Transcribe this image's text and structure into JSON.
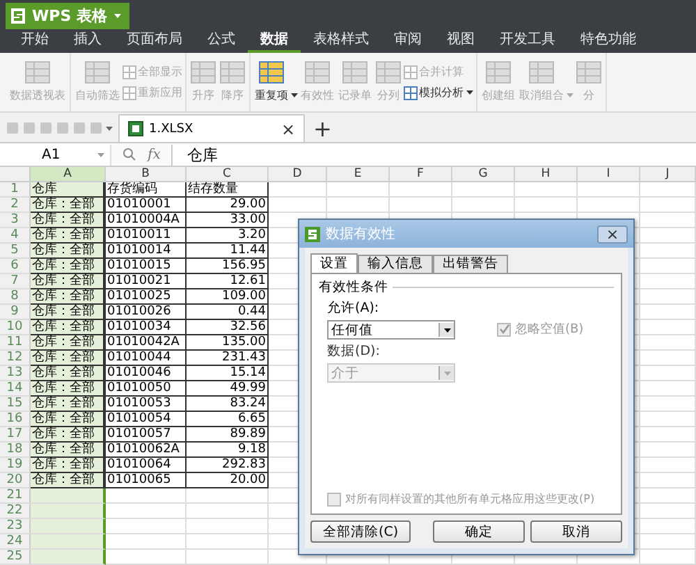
{
  "app_button": {
    "label": "WPS 表格"
  },
  "menu_tabs": [
    {
      "label": "开始",
      "selected": false
    },
    {
      "label": "插入",
      "selected": false
    },
    {
      "label": "页面布局",
      "selected": false
    },
    {
      "label": "公式",
      "selected": false
    },
    {
      "label": "数据",
      "selected": true
    },
    {
      "label": "表格样式",
      "selected": false
    },
    {
      "label": "审阅",
      "selected": false
    },
    {
      "label": "视图",
      "selected": false
    },
    {
      "label": "开发工具",
      "selected": false
    },
    {
      "label": "特色功能",
      "selected": false
    }
  ],
  "ribbon_groups": [
    {
      "items": [
        {
          "kind": "large",
          "label": "数据透视表",
          "disabled": true
        }
      ]
    },
    {
      "items": [
        {
          "kind": "large",
          "label": "自动筛选",
          "disabled": true
        },
        {
          "kind": "pair",
          "buttons": [
            {
              "label": "全部显示",
              "disabled": true
            },
            {
              "label": "重新应用",
              "disabled": true
            }
          ]
        }
      ]
    },
    {
      "items": [
        {
          "kind": "large",
          "label": "升序",
          "disabled": true
        },
        {
          "kind": "large",
          "label": "降序",
          "disabled": true
        }
      ]
    },
    {
      "items": [
        {
          "kind": "large",
          "label": "重复项",
          "disabled": false,
          "dropdown": true
        },
        {
          "kind": "large",
          "label": "有效性",
          "disabled": true
        },
        {
          "kind": "large",
          "label": "记录单",
          "disabled": true
        },
        {
          "kind": "large",
          "label": "分列",
          "disabled": true
        },
        {
          "kind": "pair",
          "buttons": [
            {
              "label": "合并计算",
              "disabled": true
            },
            {
              "label": "模拟分析",
              "disabled": false,
              "dropdown": true
            }
          ]
        }
      ]
    },
    {
      "items": [
        {
          "kind": "large",
          "label": "创建组",
          "disabled": true
        },
        {
          "kind": "large",
          "label": "取消组合",
          "disabled": true,
          "dropdown": true
        },
        {
          "kind": "large",
          "label": "分",
          "disabled": true
        }
      ]
    }
  ],
  "document_tab": {
    "label": "1.XLSX",
    "close": "×",
    "new_tab": "+"
  },
  "formula_bar": {
    "cell": "A1",
    "fx": "fx",
    "value": "仓库"
  },
  "sheet": {
    "columns": [
      {
        "label": "A",
        "selected": true
      },
      {
        "label": "B",
        "selected": false
      },
      {
        "label": "C",
        "selected": false
      },
      {
        "label": "D",
        "selected": false
      },
      {
        "label": "E",
        "selected": false
      },
      {
        "label": "F",
        "selected": false
      },
      {
        "label": "G",
        "selected": false
      },
      {
        "label": "H",
        "selected": false
      },
      {
        "label": "I",
        "selected": false
      },
      {
        "label": "J",
        "selected": false
      }
    ],
    "rows": [
      {
        "number": "1",
        "cells": [
          "仓库",
          "存货编码",
          "结存数量"
        ]
      },
      {
        "number": "2",
        "cells": [
          "仓库：全部",
          "01010001",
          "29.00"
        ]
      },
      {
        "number": "3",
        "cells": [
          "仓库：全部",
          "01010004A",
          "33.00"
        ]
      },
      {
        "number": "4",
        "cells": [
          "仓库：全部",
          "01010011",
          "3.20"
        ]
      },
      {
        "number": "5",
        "cells": [
          "仓库：全部",
          "01010014",
          "11.44"
        ]
      },
      {
        "number": "6",
        "cells": [
          "仓库：全部",
          "01010015",
          "156.95"
        ]
      },
      {
        "number": "7",
        "cells": [
          "仓库：全部",
          "01010021",
          "12.61"
        ]
      },
      {
        "number": "8",
        "cells": [
          "仓库：全部",
          "01010025",
          "109.00"
        ]
      },
      {
        "number": "9",
        "cells": [
          "仓库：全部",
          "01010026",
          "0.44"
        ]
      },
      {
        "number": "10",
        "cells": [
          "仓库：全部",
          "01010034",
          "32.56"
        ]
      },
      {
        "number": "11",
        "cells": [
          "仓库：全部",
          "01010042A",
          "135.00"
        ]
      },
      {
        "number": "12",
        "cells": [
          "仓库：全部",
          "01010044",
          "231.43"
        ]
      },
      {
        "number": "13",
        "cells": [
          "仓库：全部",
          "01010046",
          "15.14"
        ]
      },
      {
        "number": "14",
        "cells": [
          "仓库：全部",
          "01010050",
          "49.99"
        ]
      },
      {
        "number": "15",
        "cells": [
          "仓库：全部",
          "01010053",
          "83.24"
        ]
      },
      {
        "number": "16",
        "cells": [
          "仓库：全部",
          "01010054",
          "6.65"
        ]
      },
      {
        "number": "17",
        "cells": [
          "仓库：全部",
          "01010057",
          "89.89"
        ]
      },
      {
        "number": "18",
        "cells": [
          "仓库：全部",
          "01010062A",
          "9.18"
        ]
      },
      {
        "number": "19",
        "cells": [
          "仓库：全部",
          "01010064",
          "292.83"
        ]
      },
      {
        "number": "20",
        "cells": [
          "仓库：全部",
          "01010065",
          "20.00"
        ]
      },
      {
        "number": "21"
      },
      {
        "number": "22"
      },
      {
        "number": "23"
      },
      {
        "number": "24"
      },
      {
        "number": "25"
      }
    ]
  },
  "dialog": {
    "title": "数据有效性",
    "close": "×",
    "tabs": [
      {
        "label": "设置",
        "selected": true
      },
      {
        "label": "输入信息",
        "selected": false
      },
      {
        "label": "出错警告",
        "selected": false
      }
    ],
    "section": "有效性条件",
    "allow": {
      "label": "允许(A):",
      "value": "任何值",
      "disabled": false
    },
    "ignore_blank": {
      "label": "忽略空值(B)",
      "checked": true,
      "disabled": true
    },
    "data": {
      "label": "数据(D):",
      "value": "介于",
      "disabled": true
    },
    "apply_all": {
      "label": "对所有同样设置的其他所有单元格应用这些更改(P)",
      "checked": false,
      "disabled": true
    },
    "buttons": [
      {
        "label": "全部清除(C)"
      },
      {
        "label": "确定"
      },
      {
        "label": "取消"
      }
    ]
  }
}
